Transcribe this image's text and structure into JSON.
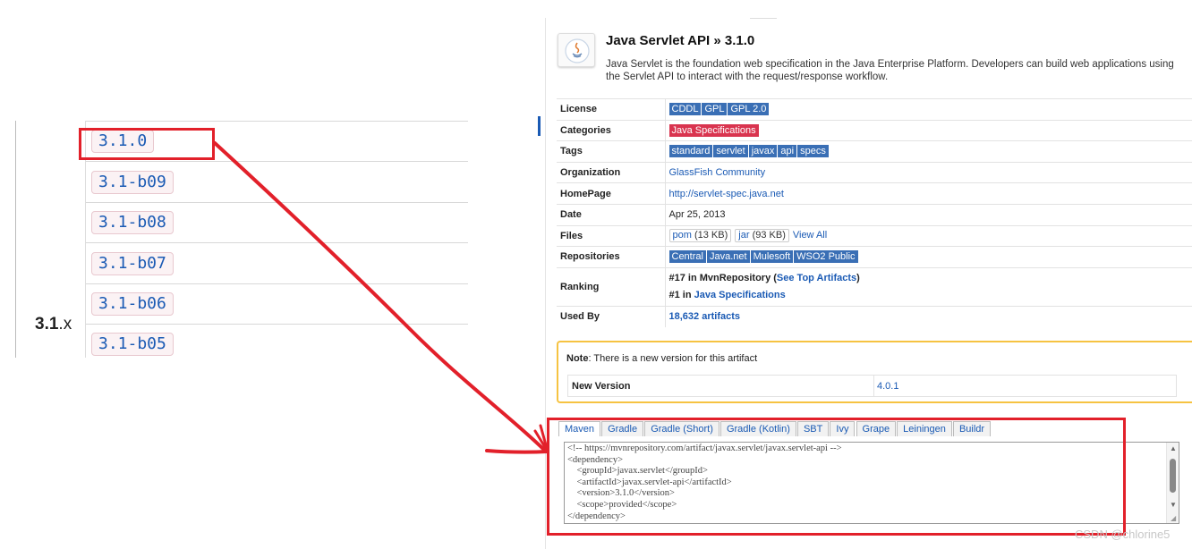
{
  "version_list": {
    "group_label_bold": "3.1",
    "group_label_rest": ".x",
    "versions": [
      "3.1.0",
      "3.1-b09",
      "3.1-b08",
      "3.1-b07",
      "3.1-b06",
      "3.1-b05"
    ]
  },
  "artifact": {
    "title": "Java Servlet API » 3.1.0",
    "description": "Java Servlet is the foundation web specification in the Java Enterprise Platform. Developers can build web applications using the Servlet API to interact with the request/response workflow.",
    "labels": {
      "license": "License",
      "categories": "Categories",
      "tags": "Tags",
      "organization": "Organization",
      "homepage": "HomePage",
      "date": "Date",
      "files": "Files",
      "repositories": "Repositories",
      "ranking": "Ranking",
      "used_by": "Used By"
    },
    "licenses": [
      "CDDL",
      "GPL",
      "GPL 2.0"
    ],
    "category": "Java Specifications",
    "tags": [
      "standard",
      "servlet",
      "javax",
      "api",
      "specs"
    ],
    "organization": "GlassFish Community",
    "homepage": "http://servlet-spec.java.net",
    "date": "Apr 25, 2013",
    "files": {
      "pom_link": "pom",
      "pom_size": "(13 KB)",
      "jar_link": "jar",
      "jar_size": "(93 KB)",
      "view_all": "View All"
    },
    "repositories": [
      "Central",
      "Java.net",
      "Mulesoft",
      "WSO2 Public"
    ],
    "ranking": {
      "line1_prefix": "#17 in MvnRepository (",
      "line1_link": "See Top Artifacts",
      "line1_suffix": ")",
      "line2_prefix": "#1 in ",
      "line2_link": "Java Specifications"
    },
    "used_by": "18,632 artifacts"
  },
  "note": {
    "bold": "Note",
    "text": ": There is a new version for this artifact",
    "new_version_label": "New Version",
    "new_version_value": "4.0.1"
  },
  "build_tabs": [
    "Maven",
    "Gradle",
    "Gradle (Short)",
    "Gradle (Kotlin)",
    "SBT",
    "Ivy",
    "Grape",
    "Leiningen",
    "Buildr"
  ],
  "snippet": "<!-- https://mvnrepository.com/artifact/javax.servlet/javax.servlet-api -->\n<dependency>\n    <groupId>javax.servlet</groupId>\n    <artifactId>javax.servlet-api</artifactId>\n    <version>3.1.0</version>\n    <scope>provided</scope>\n</dependency>",
  "watermark": "CSDN @chlorine5",
  "colors": {
    "annotation_red": "#e2202a",
    "link_blue": "#1a5ab4",
    "tag_blue": "#3a6fb5",
    "category_red": "#d9344f",
    "note_border": "#f6c342"
  }
}
